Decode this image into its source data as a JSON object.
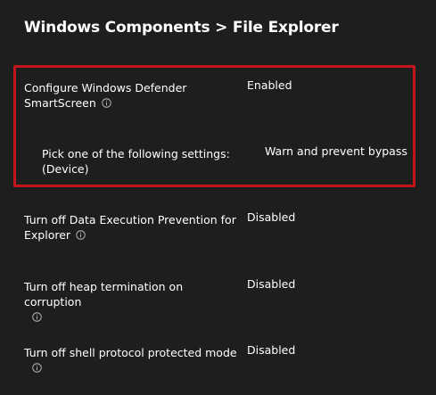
{
  "header": {
    "title": "Windows Components > File Explorer"
  },
  "settings": [
    {
      "name": "Configure Windows Defender SmartScreen",
      "value": "Enabled",
      "sub_setting": {
        "name": "Pick one of the following settings: (Device)",
        "value": "Warn and prevent bypass"
      }
    },
    {
      "name": "Turn off Data Execution Prevention for Explorer",
      "value": "Disabled"
    },
    {
      "name": "Turn off heap termination on corruption",
      "value": "Disabled"
    },
    {
      "name": "Turn off shell protocol protected mode",
      "value": "Disabled"
    }
  ],
  "colors": {
    "background": "#1e1e1e",
    "highlight_border": "#c4151c",
    "text": "#ffffff"
  },
  "icons": {
    "info": "info-icon"
  }
}
